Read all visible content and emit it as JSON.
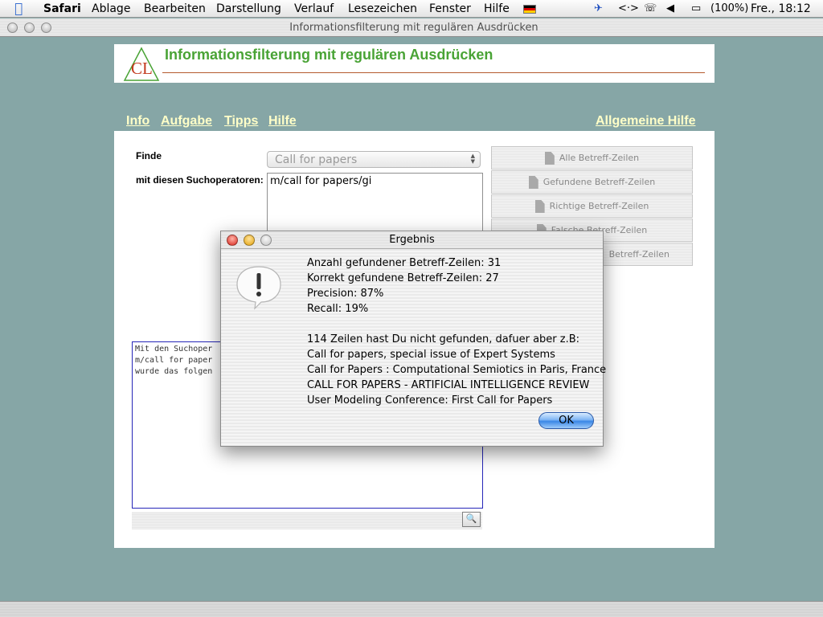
{
  "menubar": {
    "app_name": "Safari",
    "items": [
      "Ablage",
      "Bearbeiten",
      "Darstellung",
      "Verlauf",
      "Lesezeichen",
      "Fenster",
      "Hilfe"
    ],
    "battery": "(100%)",
    "clock": "Fre., 18:12",
    "icons": [
      "apple-menu-icon",
      "flag-de-icon",
      "script-icon",
      "network-icon",
      "phone-icon",
      "volume-icon",
      "battery-icon"
    ]
  },
  "window": {
    "title": "Informationsfilterung mit regulären Ausdrücken"
  },
  "page": {
    "logo_text": "CL",
    "title": "Informationsfilterung mit regulären Ausdrücken",
    "nav": {
      "info": "Info",
      "aufgabe": "Aufgabe",
      "tipps": "Tipps",
      "hilfe": "Hilfe",
      "allgemeine_hilfe": "Allgemeine Hilfe"
    },
    "form": {
      "finde_label": "Finde",
      "select_value": "Call for papers",
      "ops_label": "mit diesen Suchoperatoren:",
      "ops_value": "m/call for papers/gi"
    },
    "side_buttons": [
      "Alle Betreff-Zeilen",
      "Gefundene Betreff-Zeilen",
      "Richtige Betreff-Zeilen",
      "Falsche Betreff-Zeilen",
      "Betreff-Zeilen"
    ],
    "result_lines": [
      "Mit den Suchoper",
      "m/call for paper",
      "wurde das folgen"
    ]
  },
  "dialog": {
    "title": "Ergebnis",
    "lines": [
      "Anzahl gefundener Betreff-Zeilen: 31",
      "Korrekt gefundene Betreff-Zeilen: 27",
      "Precision: 87%",
      "Recall: 19%",
      "",
      "114 Zeilen hast Du nicht gefunden, dafuer aber z.B:",
      "Call for papers, special issue of Expert Systems",
      "Call for Papers : Computational Semiotics in Paris, France",
      "CALL FOR PAPERS - ARTIFICIAL INTELLIGENCE REVIEW",
      "User Modeling Conference: First Call for Papers"
    ],
    "ok_label": "OK"
  },
  "colors": {
    "desktop": "#86a6a6",
    "page_title": "#49a335",
    "nav_link": "#ffffc8",
    "title_rule": "#b55a2e",
    "ok_button": "#3a87e6"
  }
}
